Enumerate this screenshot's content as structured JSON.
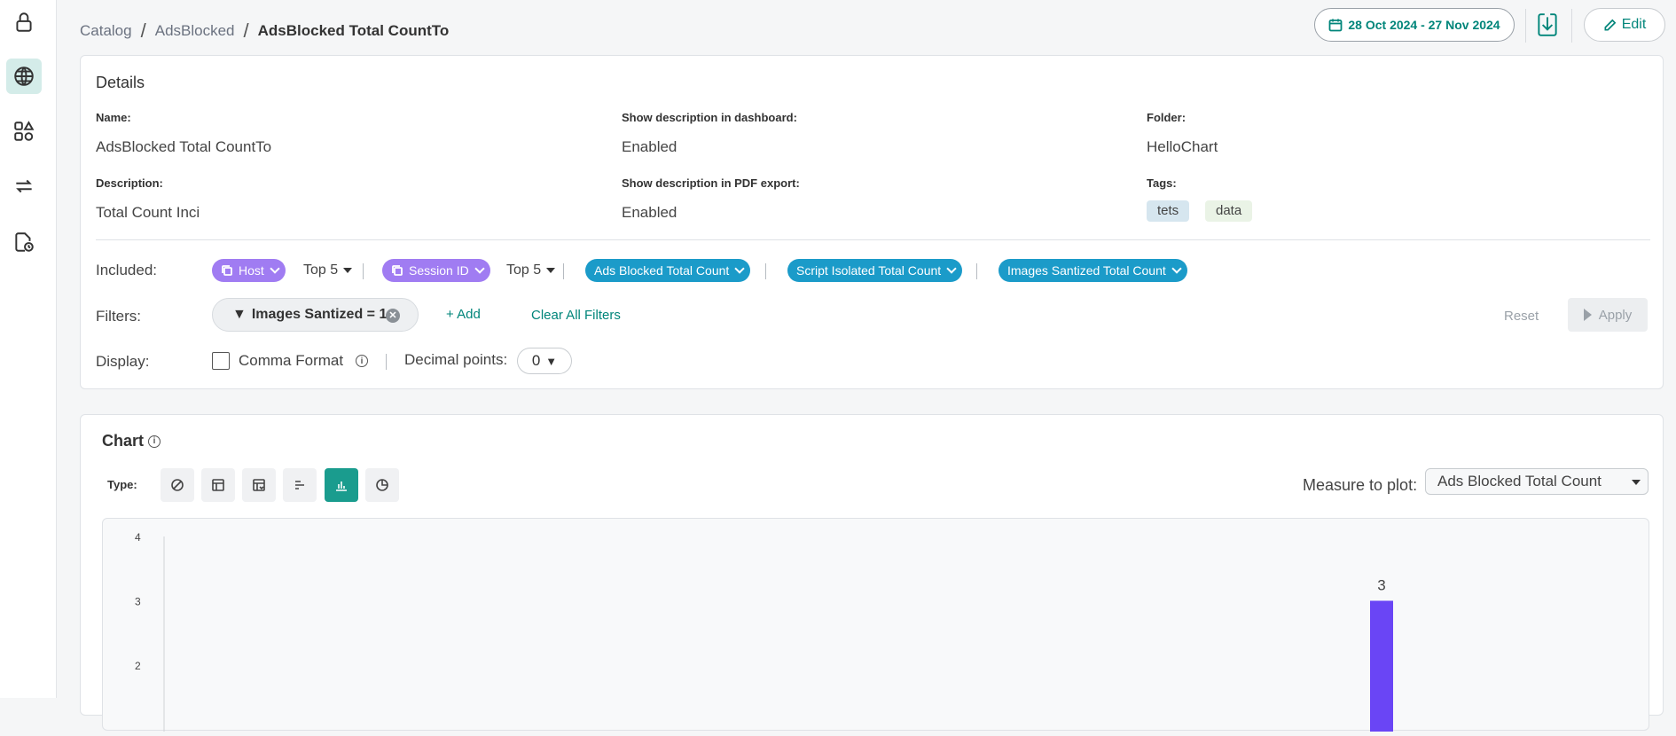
{
  "sidebar": {
    "icons": [
      "lock-icon",
      "globe-icon",
      "shapes-icon",
      "sync-icon",
      "report-schedule-icon"
    ]
  },
  "breadcrumb": {
    "items": [
      "Catalog",
      "AdsBlocked"
    ],
    "current": "AdsBlocked Total CountTo"
  },
  "header": {
    "date_range": "28 Oct 2024 - 27 Nov 2024",
    "edit_label": "Edit"
  },
  "details": {
    "title": "Details",
    "name_label": "Name:",
    "name_value": "AdsBlocked Total CountTo",
    "show_desc_dashboard_label": "Show description in dashboard:",
    "show_desc_dashboard_value": "Enabled",
    "folder_label": "Folder:",
    "folder_value": "HelloChart",
    "description_label": "Description:",
    "description_value": "Total Count Inci",
    "show_desc_pdf_label": "Show description in PDF export:",
    "show_desc_pdf_value": "Enabled",
    "tags_label": "Tags:",
    "tags": [
      "tets",
      "data"
    ]
  },
  "included": {
    "label": "Included:",
    "dimensions": [
      {
        "label": "Host",
        "top": "Top 5"
      },
      {
        "label": "Session ID",
        "top": "Top 5"
      }
    ],
    "measures": [
      "Ads Blocked Total Count",
      "Script Isolated Total Count",
      "Images Santized Total Count"
    ]
  },
  "filters": {
    "label": "Filters:",
    "active": "Images Santized = 1",
    "add_label": "+ Add",
    "clear_label": "Clear All Filters",
    "reset_label": "Reset",
    "apply_label": "Apply"
  },
  "display": {
    "label": "Display:",
    "comma_label": "Comma Format",
    "comma_checked": false,
    "decimal_label": "Decimal points:",
    "decimal_value": "0"
  },
  "chart_section": {
    "title": "Chart",
    "type_label": "Type:",
    "types": [
      "none-icon",
      "table-icon",
      "pivot-table-icon",
      "horizontal-bar-icon",
      "vertical-bar-icon",
      "pie-icon"
    ],
    "active_type": "vertical-bar-icon",
    "measure_label": "Measure to plot:",
    "measure_value": "Ads Blocked Total Count"
  },
  "chart_data": {
    "type": "bar",
    "yticks": [
      "4",
      "3",
      "2"
    ],
    "ylim": [
      0,
      4
    ],
    "values": [
      3
    ],
    "data_labels": [
      "3"
    ],
    "bar_color": "#6a45f5"
  }
}
